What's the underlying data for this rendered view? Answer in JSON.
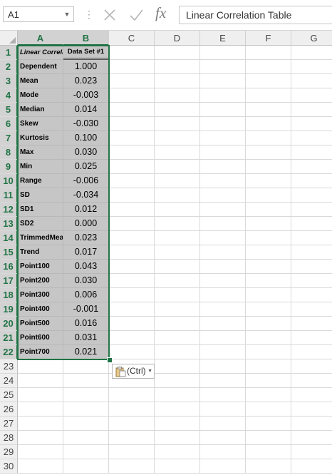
{
  "formula_bar": {
    "name_box": "A1",
    "cancel_icon": "cancel-x-icon",
    "enter_icon": "checkmark-icon",
    "fx_label": "fx",
    "formula": "Linear Correlation Table"
  },
  "columns": [
    "A",
    "B",
    "C",
    "D",
    "E",
    "F",
    "G"
  ],
  "selected_columns": [
    "A",
    "B"
  ],
  "header_row": {
    "a": "Linear Correlation Table",
    "b": "Data Set #1"
  },
  "rows": [
    {
      "label": "Dependent",
      "value": "1.000"
    },
    {
      "label": "Mean",
      "value": "0.023"
    },
    {
      "label": "Mode",
      "value": "-0.003"
    },
    {
      "label": "Median",
      "value": "0.014"
    },
    {
      "label": "Skew",
      "value": "-0.030"
    },
    {
      "label": "Kurtosis",
      "value": "0.100"
    },
    {
      "label": "Max",
      "value": "0.030"
    },
    {
      "label": "Min",
      "value": "0.025"
    },
    {
      "label": "Range",
      "value": "-0.006"
    },
    {
      "label": "SD",
      "value": "-0.034"
    },
    {
      "label": "SD1",
      "value": "0.012"
    },
    {
      "label": "SD2",
      "value": "0.000"
    },
    {
      "label": "TrimmedMean",
      "value": "0.023"
    },
    {
      "label": "Trend",
      "value": "0.017"
    },
    {
      "label": "Point100",
      "value": "0.043"
    },
    {
      "label": "Point200",
      "value": "0.030"
    },
    {
      "label": "Point300",
      "value": "0.006"
    },
    {
      "label": "Point400",
      "value": "-0.001"
    },
    {
      "label": "Point500",
      "value": "0.016"
    },
    {
      "label": "Point600",
      "value": "0.031"
    },
    {
      "label": "Point700",
      "value": "0.021"
    }
  ],
  "row_numbers": [
    "1",
    "2",
    "3",
    "4",
    "5",
    "6",
    "7",
    "8",
    "9",
    "10",
    "11",
    "12",
    "13",
    "14",
    "15",
    "16",
    "17",
    "18",
    "19",
    "20",
    "21",
    "22",
    "23",
    "24",
    "25",
    "26",
    "27",
    "28",
    "29",
    "30"
  ],
  "paste_options": {
    "label": "(Ctrl)",
    "icon": "clipboard-icon"
  },
  "colors": {
    "accent": "#217346",
    "selection": "#c6c6c6"
  }
}
